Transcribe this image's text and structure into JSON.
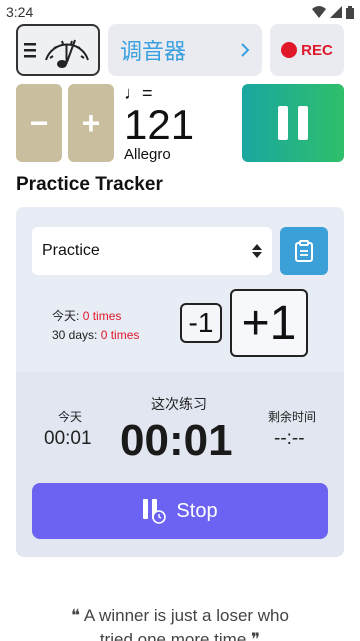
{
  "status": {
    "time": "3:24"
  },
  "top": {
    "tuner_label": "调音器",
    "rec_label": "REC"
  },
  "tempo": {
    "minus": "−",
    "plus": "+",
    "note": "♩=",
    "bpm": "121",
    "name": "Allegro"
  },
  "tracker": {
    "title": "Practice Tracker",
    "selected": "Practice",
    "today_label": "今天:",
    "today_value": "0 times",
    "days_label": "30 days:",
    "days_value": "0 times",
    "minus_one": "-1",
    "plus_one": "+1",
    "today_timer_label": "今天",
    "today_timer": "00:01",
    "session_label": "这次练习",
    "session_timer": "00:01",
    "remaining_label": "剩余时间",
    "remaining_timer": "--:--",
    "stop_label": "Stop"
  },
  "quote": {
    "line1": "❝ A winner is just a loser who",
    "line2": "tried one more time ❞"
  },
  "colors": {
    "accent_blue": "#3ca0d8",
    "record_red": "#e0182a",
    "stop_purple": "#6c63f2",
    "play_green": "#2fbf6a",
    "tempo_tan": "#c9bf9e"
  }
}
